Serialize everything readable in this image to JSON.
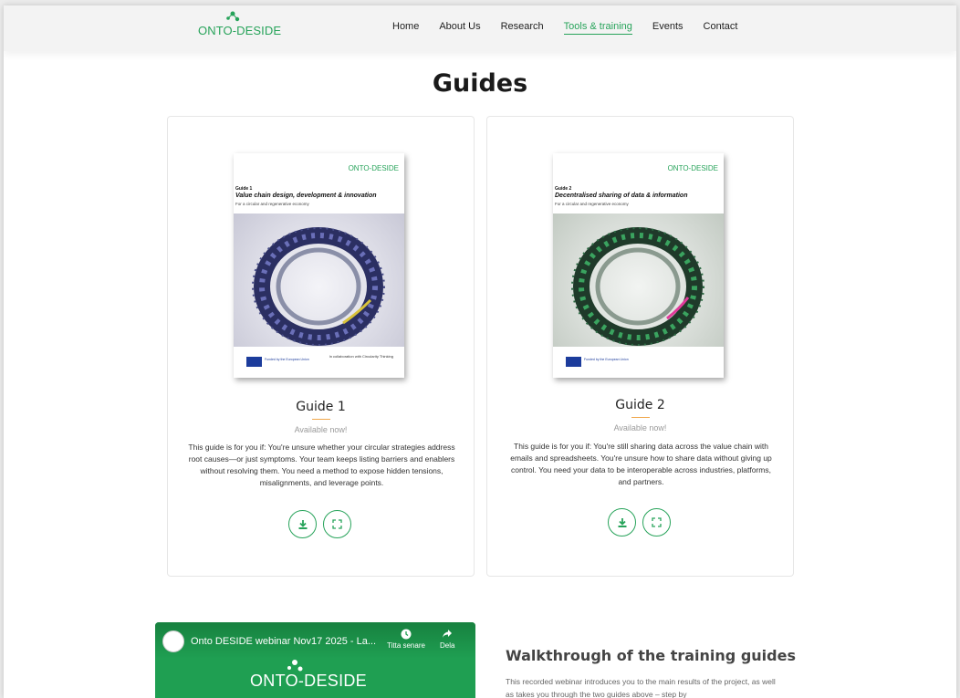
{
  "header": {
    "logo_text": "ONTO-DESIDE",
    "nav": [
      "Home",
      "About Us",
      "Research",
      "Tools & training",
      "Events",
      "Contact"
    ],
    "active": "Tools & training"
  },
  "main": {
    "title": "Guides",
    "cards": [
      {
        "cover": {
          "logo": "ONTO-DESIDE",
          "guide_label": "Guide 1",
          "title": "Value chain design, development & innovation",
          "subtitle": "For a circular and regenerative economy",
          "eu_text": "Funded by the European Union",
          "partner_text": "In collaboration with Circularity Thinking"
        },
        "title": "Guide 1",
        "status": "Available now!",
        "description": "This guide is for you if: You're unsure whether your circular strategies address root causes—or just symptoms. Your team keeps listing barriers and enablers without resolving them. You need a method to expose hidden tensions, misalignments, and leverage points."
      },
      {
        "cover": {
          "logo": "ONTO-DESIDE",
          "guide_label": "Guide 2",
          "title": "Decentralised sharing of data & information",
          "subtitle": "For a circular and regenerative economy",
          "eu_text": "Funded by the European Union",
          "partner_text": ""
        },
        "title": "Guide 2",
        "status": "Available now!",
        "description": "This guide is for you if: You're still sharing data across the value chain with emails and spreadsheets. You're unsure how to share data without giving up control. You need your data to be interoperable across industries, platforms, and partners."
      }
    ]
  },
  "video": {
    "title": "Onto DESIDE webinar Nov17 2025 - La...",
    "watch_later": "Titta senare",
    "share": "Dela",
    "logo_text": "ONTO-DESIDE"
  },
  "walkthrough": {
    "title": "Walkthrough of the training guides",
    "text": "This recorded webinar introduces you to the main results of the project, as well as takes you through the two guides above – step by"
  },
  "colors": {
    "brand_green": "#27a35a",
    "accent_orange": "#f0a64a"
  }
}
